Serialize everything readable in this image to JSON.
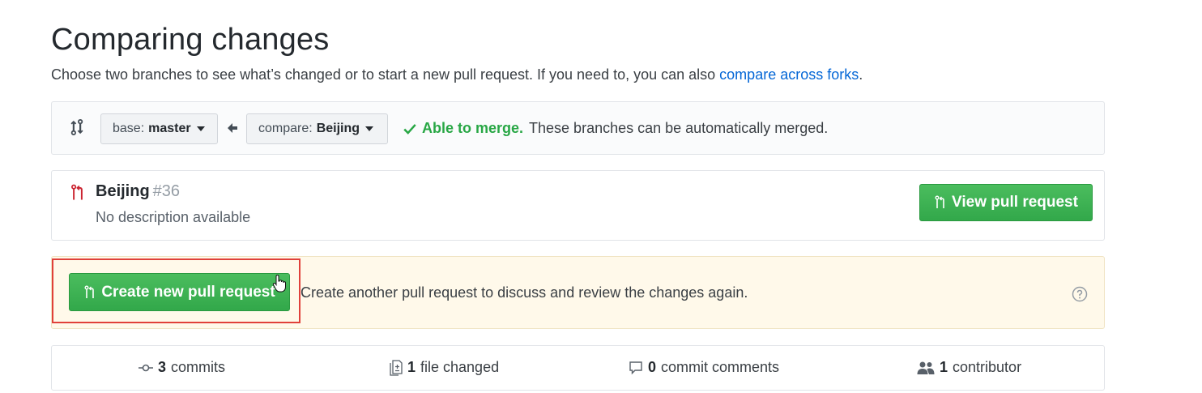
{
  "header": {
    "title": "Comparing changes",
    "subtitle_prefix": "Choose two branches to see what’s changed or to start a new pull request. If you need to, you can also ",
    "subtitle_link": "compare across forks",
    "subtitle_suffix": "."
  },
  "range": {
    "base_label": "base:",
    "base_value": "master",
    "compare_label": "compare:",
    "compare_value": "Beijing",
    "merge_ok": "Able to merge.",
    "merge_text": "These branches can be automatically merged."
  },
  "existing_pr": {
    "name": "Beijing",
    "number": "#36",
    "description": "No description available",
    "view_button": "View pull request"
  },
  "create": {
    "button": "Create new pull request",
    "text": "Create another pull request to discuss and review the changes again."
  },
  "summary": {
    "commits_count": "3",
    "commits_label": "commits",
    "files_count": "1",
    "files_label": "file changed",
    "comments_count": "0",
    "comments_label": "commit comments",
    "contributors_count": "1",
    "contributors_label": "contributor"
  },
  "colors": {
    "green": "#2ea44f",
    "link": "#0366d6",
    "highlight": "#e0403a",
    "pr_icon": "#cb2431"
  }
}
